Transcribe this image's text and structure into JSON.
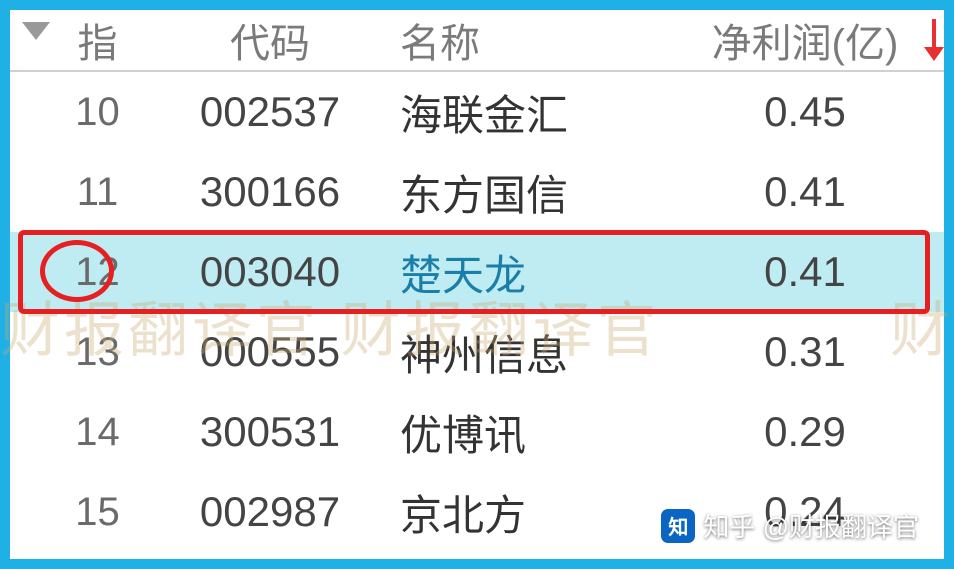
{
  "header": {
    "indicator_label": "指",
    "code_label": "代码",
    "name_label": "名称",
    "profit_label": "净利润(亿)"
  },
  "rows": [
    {
      "idx": "10",
      "code": "002537",
      "name": "海联金汇",
      "profit": "0.45",
      "highlighted": false
    },
    {
      "idx": "11",
      "code": "300166",
      "name": "东方国信",
      "profit": "0.41",
      "highlighted": false
    },
    {
      "idx": "12",
      "code": "003040",
      "name": "楚天龙",
      "profit": "0.41",
      "highlighted": true
    },
    {
      "idx": "13",
      "code": "000555",
      "name": "神州信息",
      "profit": "0.31",
      "highlighted": false
    },
    {
      "idx": "14",
      "code": "300531",
      "name": "优博讯",
      "profit": "0.29",
      "highlighted": false
    },
    {
      "idx": "15",
      "code": "002987",
      "name": "京北方",
      "profit": "0.24",
      "highlighted": false
    }
  ],
  "watermark_text": "财报翻译官  财报翻译官",
  "watermark_text2": "财",
  "zhihu": {
    "icon_text": "知",
    "author": "知乎 @财报翻译官"
  }
}
